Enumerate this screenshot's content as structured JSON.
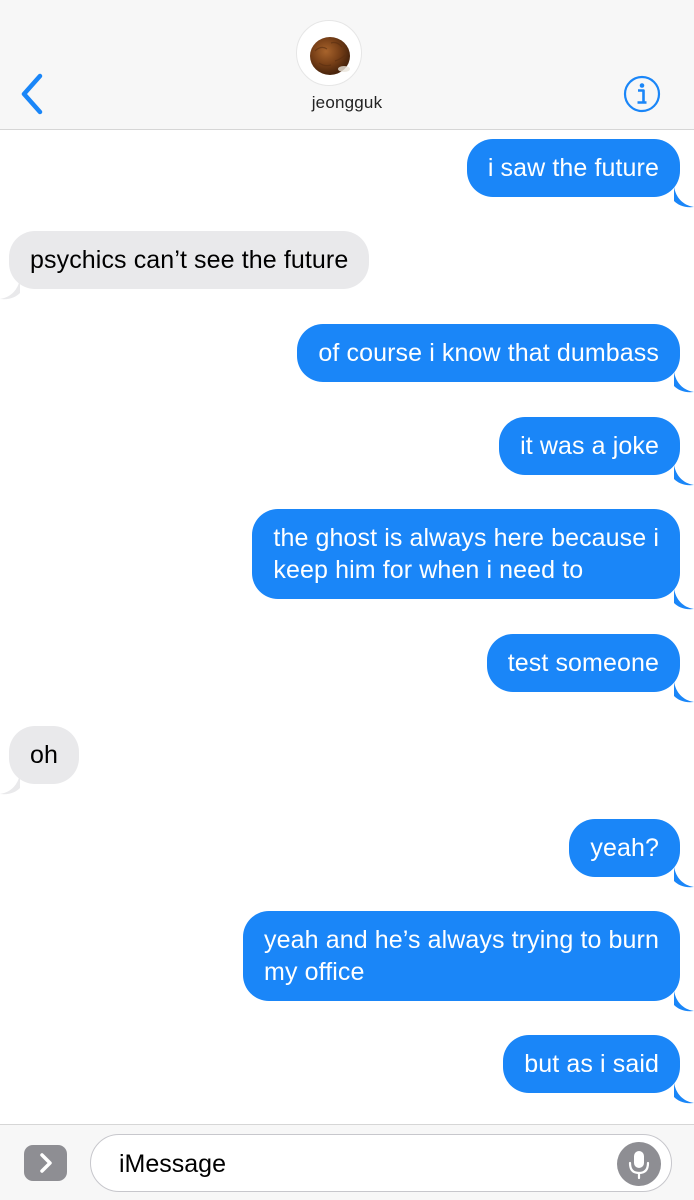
{
  "header": {
    "contact_name": "jeongguk",
    "back_icon": "chevron-left-icon",
    "info_icon": "info-icon",
    "accent_color": "#1a86f8"
  },
  "messages": [
    {
      "direction": "sent",
      "text": "i saw the future"
    },
    {
      "direction": "received",
      "text": "psychics can’t see the future"
    },
    {
      "direction": "sent",
      "text": "of course i know that dumbass"
    },
    {
      "direction": "sent",
      "text": "it was a joke"
    },
    {
      "direction": "sent",
      "text": "the ghost is always here because i\nkeep him for when i need to"
    },
    {
      "direction": "sent",
      "text": "test someone"
    },
    {
      "direction": "received",
      "text": "oh"
    },
    {
      "direction": "sent",
      "text": "yeah?"
    },
    {
      "direction": "sent",
      "text": "yeah and he’s always trying to burn\nmy office"
    },
    {
      "direction": "sent",
      "text": "but as i said"
    }
  ],
  "composer": {
    "placeholder": "iMessage",
    "apps_icon": "chevron-right-icon",
    "mic_icon": "microphone-icon"
  },
  "colors": {
    "sent_bubble": "#1a86f8",
    "received_bubble": "#e9e9eb"
  }
}
